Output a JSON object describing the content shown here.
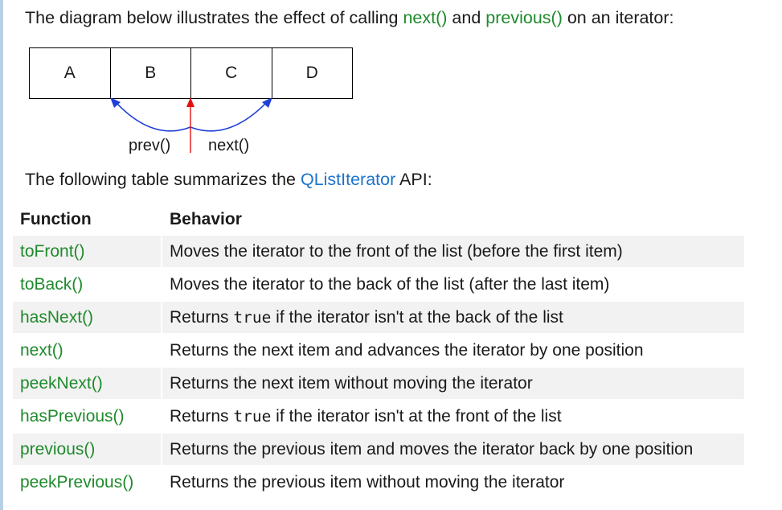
{
  "intro": {
    "before": "The diagram below illustrates the effect of calling ",
    "next_link": "next()",
    "middle": " and ",
    "previous_link": "previous()",
    "after": " on an iterator:"
  },
  "diagram": {
    "cells": [
      "A",
      "B",
      "C",
      "D"
    ],
    "prev_label": "prev()",
    "next_label": "next()",
    "colors": {
      "side_arrows": "#1f3fd6",
      "center_arrow": "#e01010"
    }
  },
  "summary": {
    "before": "The following table summarizes the ",
    "class_link": "QListIterator",
    "after": " API:"
  },
  "table": {
    "headers": {
      "function": "Function",
      "behavior": "Behavior"
    },
    "rows": [
      {
        "function": "toFront()",
        "behavior": [
          "Moves the iterator to the front of the list (before the first item)"
        ]
      },
      {
        "function": "toBack()",
        "behavior": [
          "Moves the iterator to the back of the list (after the last item)"
        ]
      },
      {
        "function": "hasNext()",
        "behavior": [
          "Returns ",
          "true",
          " if the iterator isn't at the back of the list"
        ]
      },
      {
        "function": "next()",
        "behavior": [
          "Returns the next item and advances the iterator by one position"
        ]
      },
      {
        "function": "peekNext()",
        "behavior": [
          "Returns the next item without moving the iterator"
        ]
      },
      {
        "function": "hasPrevious()",
        "behavior": [
          "Returns ",
          "true",
          " if the iterator isn't at the front of the list"
        ]
      },
      {
        "function": "previous()",
        "behavior": [
          "Returns the previous item and moves the iterator back by one position"
        ]
      },
      {
        "function": "peekPrevious()",
        "behavior": [
          "Returns the previous item without moving the iterator"
        ]
      }
    ],
    "colors": {
      "function_link": "#1f8a2c",
      "shaded_row": "#f2f2f2"
    }
  }
}
